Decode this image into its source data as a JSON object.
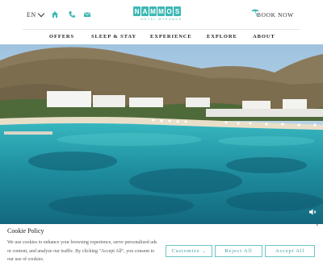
{
  "header": {
    "language": "EN",
    "logo": {
      "letters": [
        "N",
        "A",
        "M",
        "M",
        "O",
        "S"
      ],
      "subtitle": "HOTEL MYKONOS"
    },
    "book_label": "BOOK NOW",
    "icons": [
      "home-icon",
      "phone-icon",
      "mail-icon",
      "umbrella-icon"
    ]
  },
  "nav": {
    "items": [
      "OFFERS",
      "SLEEP & STAY",
      "EXPERIENCE",
      "EXPLORE",
      "ABOUT"
    ]
  },
  "cookie": {
    "title": "Cookie Policy",
    "text": "We use cookies to enhance your browsing experience, serve personalized ads or content, and analyze our traffic. By clicking \"Accept All\", you consent to our use of cookies.",
    "close": "×",
    "buttons": {
      "customize": "Customize",
      "reject": "Reject All",
      "accept": "Accept All"
    }
  },
  "colors": {
    "brand": "#3fb8b4",
    "button_border": "#6fc4c6"
  }
}
